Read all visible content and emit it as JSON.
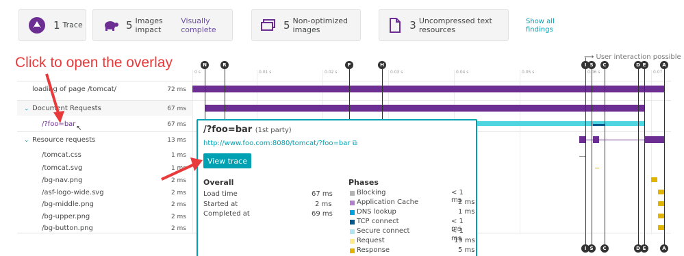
{
  "cards": [
    {
      "count": "1",
      "label": "Trace",
      "link": "",
      "icon": "trace-logo-icon"
    },
    {
      "count": "5",
      "label": "Images impact",
      "link": "Visually complete",
      "icon": "turtle-icon"
    },
    {
      "count": "5",
      "label": "Non-optimized images",
      "link": "",
      "icon": "images-stack-icon"
    },
    {
      "count": "3",
      "label": "Uncompressed text resources",
      "link": "",
      "icon": "document-icon"
    }
  ],
  "show_all": "Show all findings",
  "annotation": "Click to open the overlay",
  "user_interaction": "User interaction possible",
  "axis_ticks": [
    "0 s",
    "0.01 s",
    "0.02 s",
    "0.03 s",
    "0.04 s",
    "0.05 s",
    "0.06 s",
    "0.07"
  ],
  "rows": [
    {
      "name": "loading of page /tomcat/",
      "duration": "72 ms"
    },
    {
      "name": "Document Requests",
      "duration": "67 ms"
    },
    {
      "name": "/?foo=bar",
      "duration": "67 ms"
    },
    {
      "name": "Resource requests",
      "duration": "13 ms"
    },
    {
      "name": "/tomcat.css",
      "duration": "1 ms"
    },
    {
      "name": "/tomcat.svg",
      "duration": "1 ms"
    },
    {
      "name": "/bg-nav.png",
      "duration": "2 ms"
    },
    {
      "name": "/asf-logo-wide.svg",
      "duration": "2 ms"
    },
    {
      "name": "/bg-middle.png",
      "duration": "2 ms"
    },
    {
      "name": "/bg-upper.png",
      "duration": "2 ms"
    },
    {
      "name": "/bg-button.png",
      "duration": "2 ms"
    }
  ],
  "markers_top": [
    "N",
    "R",
    "F",
    "H",
    "I",
    "S",
    "C",
    "D",
    "E",
    "A"
  ],
  "markers_bottom": [
    "I",
    "S",
    "C",
    "D",
    "E",
    "A"
  ],
  "overlay": {
    "title": "/?foo=bar",
    "party": "(1st party)",
    "url": "http://www.foo.com:8080/tomcat/?foo=bar",
    "button": "View trace",
    "overall_heading": "Overall",
    "overall": [
      {
        "label": "Load time",
        "value": "67 ms"
      },
      {
        "label": "Started at",
        "value": "2 ms"
      },
      {
        "label": "Completed at",
        "value": "69 ms"
      }
    ],
    "phases_heading": "Phases",
    "phases": [
      {
        "label": "Blocking",
        "value": "< 1 ms",
        "color": "#b4b4b4"
      },
      {
        "label": "Application Cache",
        "value": "2 ms",
        "color": "#b57fd0"
      },
      {
        "label": "DNS lookup",
        "value": "1 ms",
        "color": "#00a1e0"
      },
      {
        "label": "TCP connect",
        "value": "< 1 ms",
        "color": "#005a8c"
      },
      {
        "label": "Secure connect",
        "value": "< 1 ms",
        "color": "#b3e4f2"
      },
      {
        "label": "Request",
        "value": "19 ms",
        "color": "#ffe98a"
      },
      {
        "label": "Response",
        "value": "5 ms",
        "color": "#e0b400"
      }
    ]
  },
  "colors": {
    "accent": "#00a1b2",
    "purple": "#6d2e93",
    "cyan": "#4fd5e0",
    "gold": "#e0b400"
  }
}
